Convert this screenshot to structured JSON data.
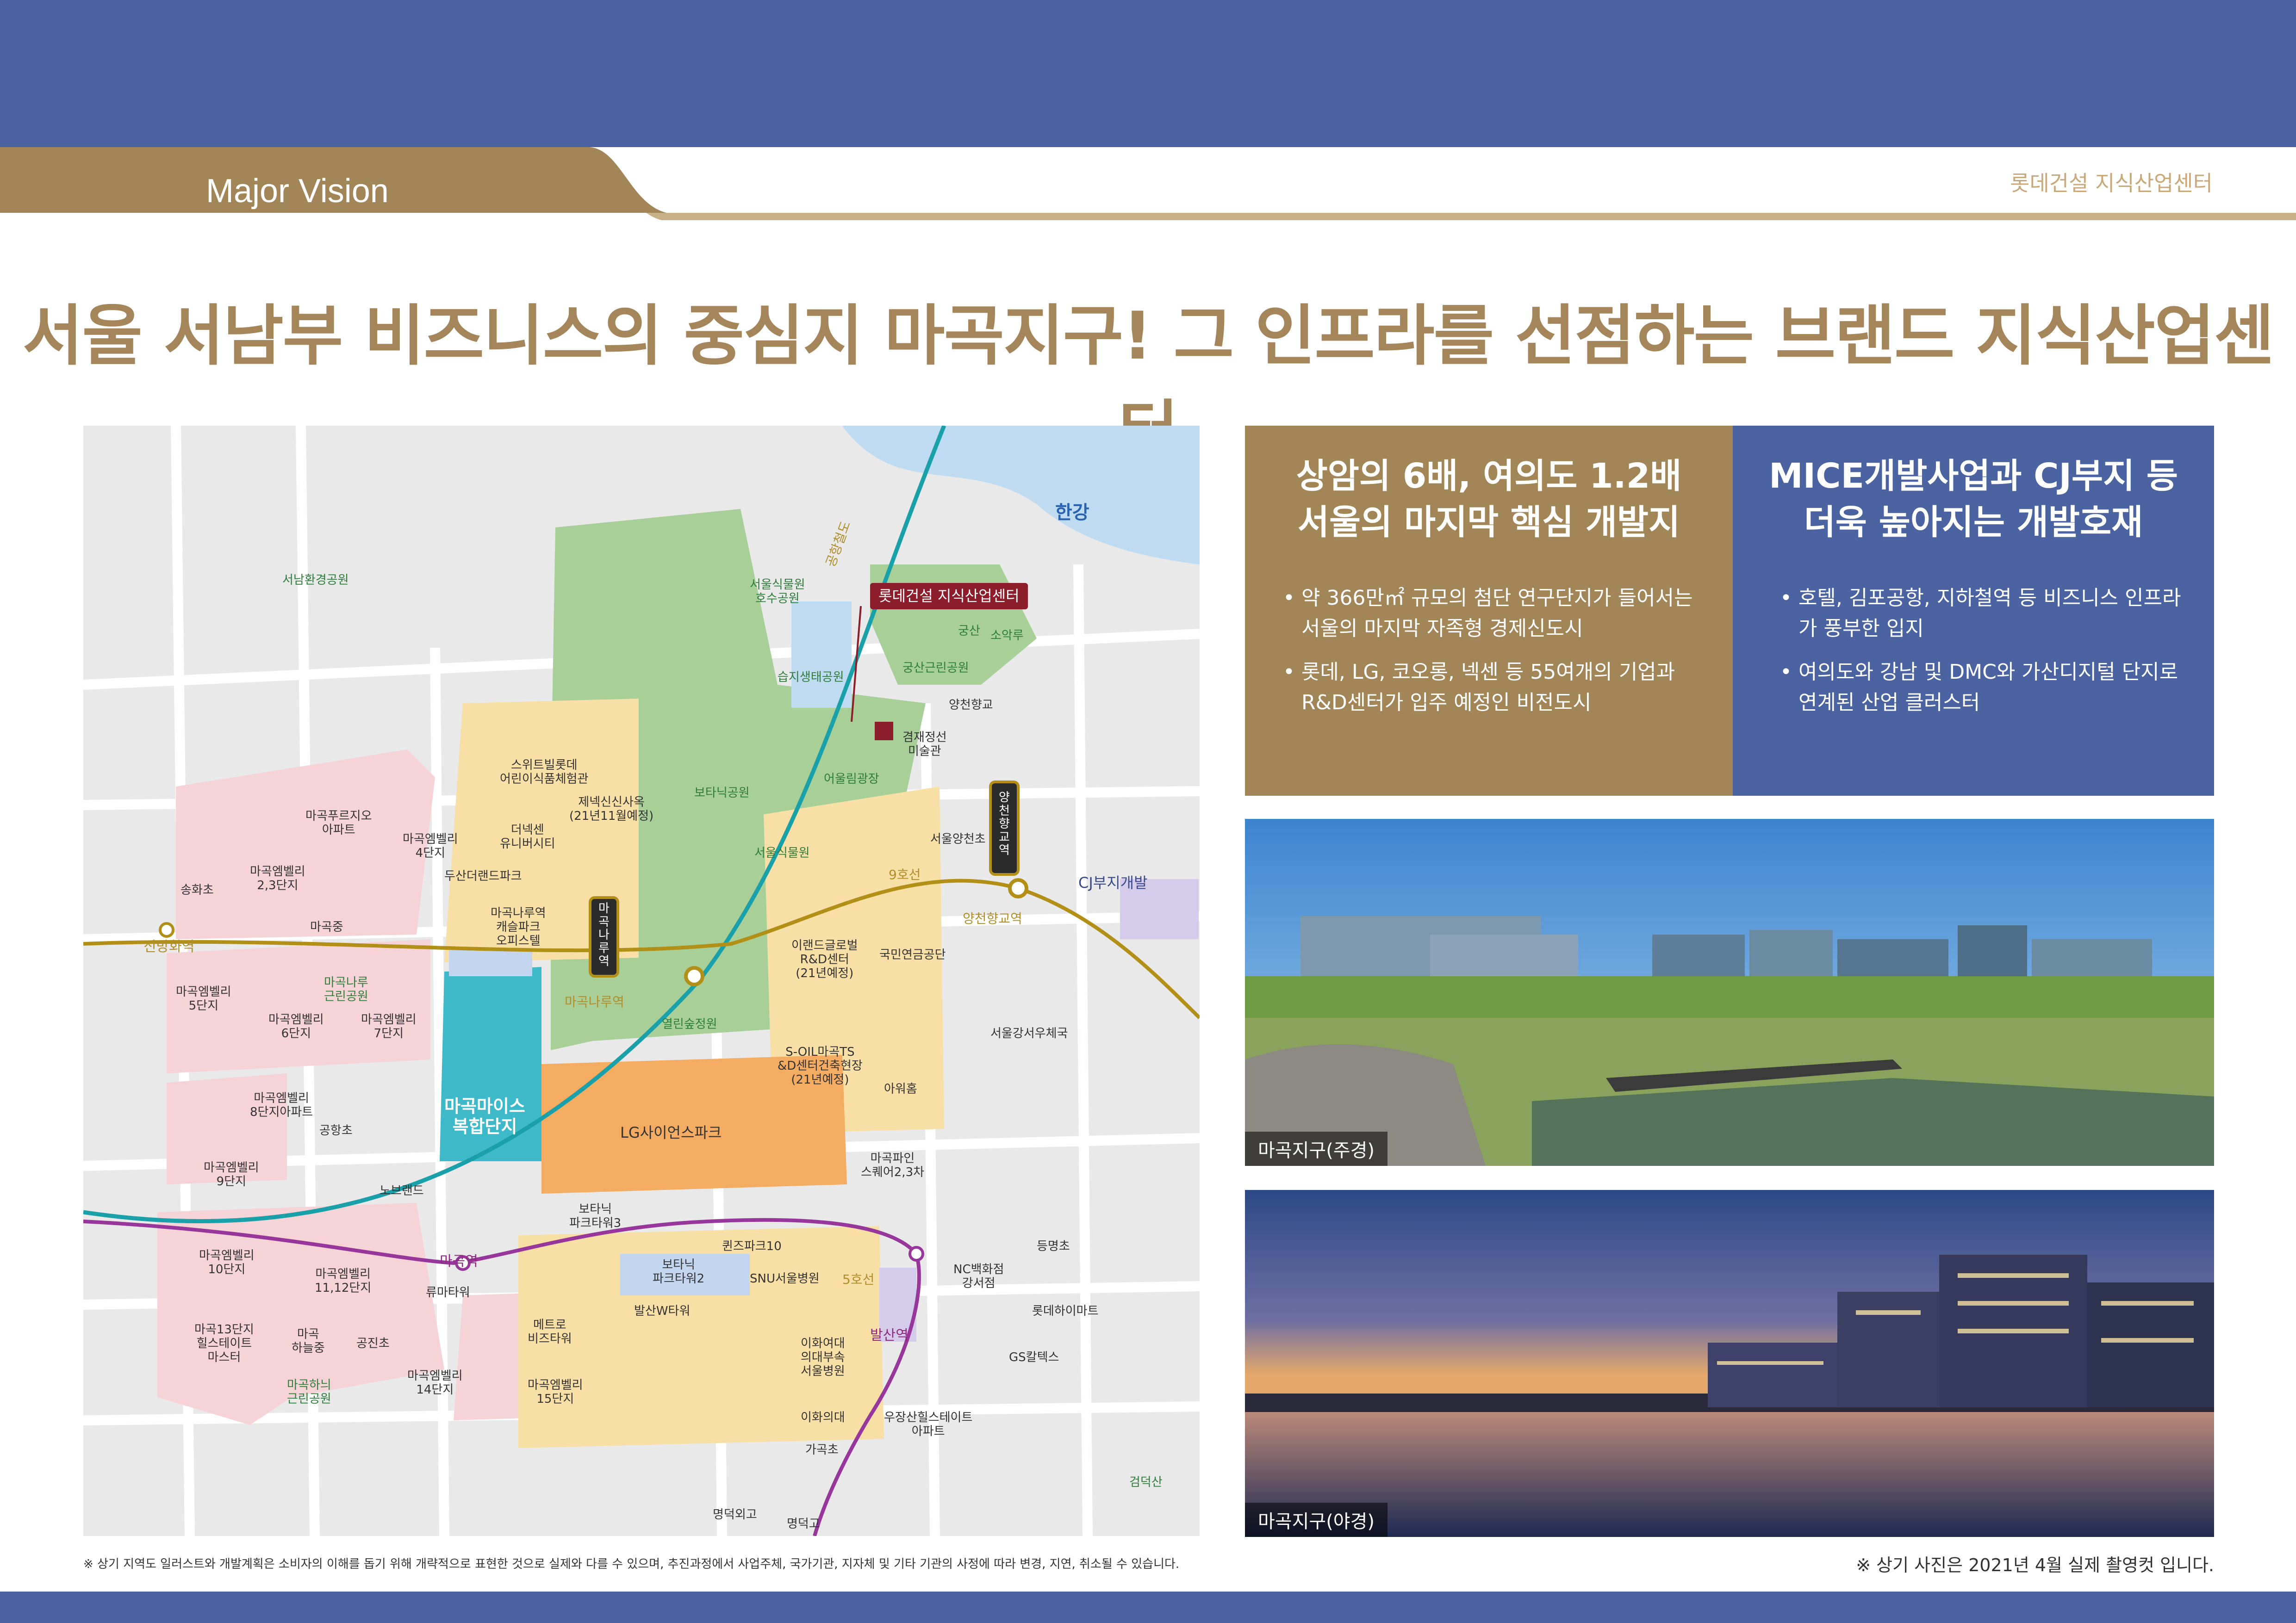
{
  "header": {
    "section_label": "Major Vision",
    "brand": "롯데건설 지식산업센터",
    "headline": "서울 서남부 비즈니스의 중심지 마곡지구! 그 인프라를 선점하는 브랜드 지식산업센터"
  },
  "colors": {
    "navy": "#4b63a0",
    "gold": "#a38658",
    "headline": "#a5855a"
  },
  "map": {
    "labels": {
      "hangang": "한강",
      "seonam_park": "서남환경공원",
      "seoul_botanic_lake": "서울식물원\n호수공원",
      "wetland": "습지생태공원",
      "gungsan_park": "궁산근린공원",
      "gungsan": "궁산",
      "soakru": "소악루",
      "yangcheon_hyanggyo": "양천향교",
      "gyeomjae": "겸재정선\n미술관",
      "botanic_park": "보타닉공원",
      "children_park": "어울림광장",
      "seoul_botanic": "서울식물원",
      "yangcheon_school": "서울양천초",
      "line9": "9호선",
      "airport_line": "공항철도",
      "line5": "5호선",
      "cj_site": "CJ부지개발",
      "swit_lotte": "스위트빌롯데\n어린이식품체험관",
      "dongnek": "더넥센\n유니버시티",
      "jenecs": "제넥신신사옥\n(21년11월예정)",
      "magok_prugio": "마곡푸르지오\n아파트",
      "magok_valley4": "마곡엠벨리\n4단지",
      "dusan": "두산더랜드파크",
      "magok_valley23": "마곡엠벨리\n2,3단지",
      "songhwa": "송화초",
      "magok_middle": "마곡중",
      "magoknaru_square": "마곡나루역\n캐슬파크\n오피스텔",
      "sinbanghwa": "신방화역",
      "magoknaru_park": "마곡나루\n근린공원",
      "valley5": "마곡엠벨리\n5단지",
      "valley6": "마곡엠벨리\n6단지",
      "valley7": "마곡엠벨리\n7단지",
      "magoknaru_station": "마곡나루역",
      "magoknaru_sign": "마곡나루역",
      "yangcheon_sign": "양천향교역",
      "yangcheon_station": "양천향교역",
      "east_park": "열린숲정원",
      "emart": "이랜드글로벌\nR&D센터\n(21년예정)",
      "pension": "국민연금공단",
      "post_office": "서울강서우체국",
      "soil": "S-OIL마곡TS\n&D센터건축현장\n(21년예정)",
      "aiwan": "아워홈",
      "valley8": "마곡엠벨리\n8단지아파트",
      "mice": "마곡마이스\n복합단지",
      "gonghang_school": "공항초",
      "lg": "LG사이언스파크",
      "magokpine": "마곡파인\n스퀘어2,3차",
      "valley9": "마곡엠벨리\n9단지",
      "norae": "노브랜드",
      "botanic_tower3": "보타닉\n파크타워3",
      "queens": "퀸즈파크10",
      "dm_school": "등명초",
      "magok_station": "마곡역",
      "botanic_tower2": "보타닉\n파크타워2",
      "snu": "SNU서울병원",
      "nc": "NC백화점\n강서점",
      "valley10": "마곡엠벨리\n10단지",
      "valley11": "마곡엠벨리\n11,12단지",
      "ryu_tower": "류마타워",
      "lotte_himart": "롯데하이마트",
      "balsan_tower": "발산W타워",
      "balsan_station": "발산역",
      "valley13": "마곡13단지\n힐스테이트\n마스터",
      "haneul_school": "마곡\n하늘중",
      "gongjin": "공진초",
      "metro_tower": "메트로\n비즈타워",
      "ewha": "이화여대\n의대부속\n서울병원",
      "gs": "GS칼텍스",
      "haneul_park": "마곡하늬\n근린공원",
      "valley14": "마곡엠벨리\n14단지",
      "valley15": "마곡엠벨리\n15단지",
      "ewha_univ": "이화의대",
      "woojang": "우장산힐스테이트\n아파트",
      "gacheong": "가곡초",
      "geomdeoksan": "검덕산",
      "myeongdeok_high": "명덕외고",
      "myeongdeok_high2": "명덕고",
      "lotte_site": "롯데건설 지식산업센터"
    },
    "footnote": "※ 상기 지역도 일러스트와 개발계획은 소비자의 이해를 돕기 위해 개략적으로 표현한 것으로 실제와 다를 수 있으며, 추진과정에서 사업주체, 국가기관, 지자체 및 기타 기관의 사정에 따라 변경, 지연, 취소될 수 있습니다."
  },
  "panels": {
    "left": {
      "title_1": "상암의 6배, 여의도 1.2배",
      "title_2": "서울의 마지막 핵심 개발지",
      "bullets": [
        "약 366만㎡ 규모의 첨단 연구단지가 들어서는 서울의 마지막 자족형 경제신도시",
        "롯데, LG, 코오롱, 넥센 등 55여개의 기업과 R&D센터가 입주 예정인 비전도시"
      ]
    },
    "right": {
      "title_1": "MICE개발사업과 CJ부지 등",
      "title_2": "더욱 높아지는 개발호재",
      "bullets": [
        "호텔, 김포공항, 지하철역 등 비즈니스 인프라가 풍부한 입지",
        "여의도와 강남 및 DMC와 가산디지털 단지로 연계된 산업 클러스터"
      ]
    }
  },
  "photos": {
    "day_caption": "마곡지구(주경)",
    "night_caption": "마곡지구(야경)",
    "note": "※ 상기 사진은 2021년 4월 실제 촬영컷 입니다."
  }
}
